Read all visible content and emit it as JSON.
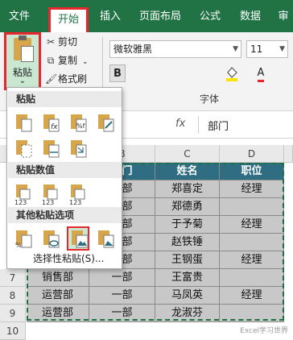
{
  "ribbon_tabs": [
    "文件",
    "开始",
    "插入",
    "页面布局",
    "公式",
    "数据",
    "审"
  ],
  "active_tab": "开始",
  "clipboard": {
    "paste_label": "粘贴",
    "cut_label": "剪切",
    "copy_label": "复制",
    "format_painter_label": "格式刷"
  },
  "font": {
    "name": "微软雅黑",
    "size": "11",
    "bold_label": "B",
    "group_label": "字体"
  },
  "formula_bar": {
    "fx_label": "fx",
    "content": "部门"
  },
  "paste_menu": {
    "section1": "粘贴",
    "section2": "粘贴数值",
    "section3": "其他粘贴选项",
    "paste_special": "选择性粘贴(S)..."
  },
  "grid": {
    "columns": [
      "B",
      "C",
      "D"
    ],
    "visible_rows": [
      "7",
      "8",
      "9",
      "10"
    ],
    "header_row": [
      "部门",
      "姓名",
      "职位"
    ],
    "rows": [
      [
        "一部",
        "郑喜定",
        "经理"
      ],
      [
        "一部",
        "郑德勇",
        ""
      ],
      [
        "一部",
        "于予菊",
        "经理"
      ],
      [
        "一部",
        "赵铁锤",
        ""
      ],
      [
        "一部",
        "王钢蛋",
        "经理"
      ],
      [
        "销售部",
        "一部",
        "王富贵",
        ""
      ],
      [
        "运营部",
        "一部",
        "马凤英",
        "经理"
      ],
      [
        "运营部",
        "一部",
        "龙淑芬",
        ""
      ]
    ]
  },
  "watermark": "Excel学习世界",
  "colors": {
    "ribbon_green": "#217346",
    "header_fill": "#2f6e82",
    "body_fill": "#c8c8c8",
    "highlight_red": "#e8262c"
  }
}
